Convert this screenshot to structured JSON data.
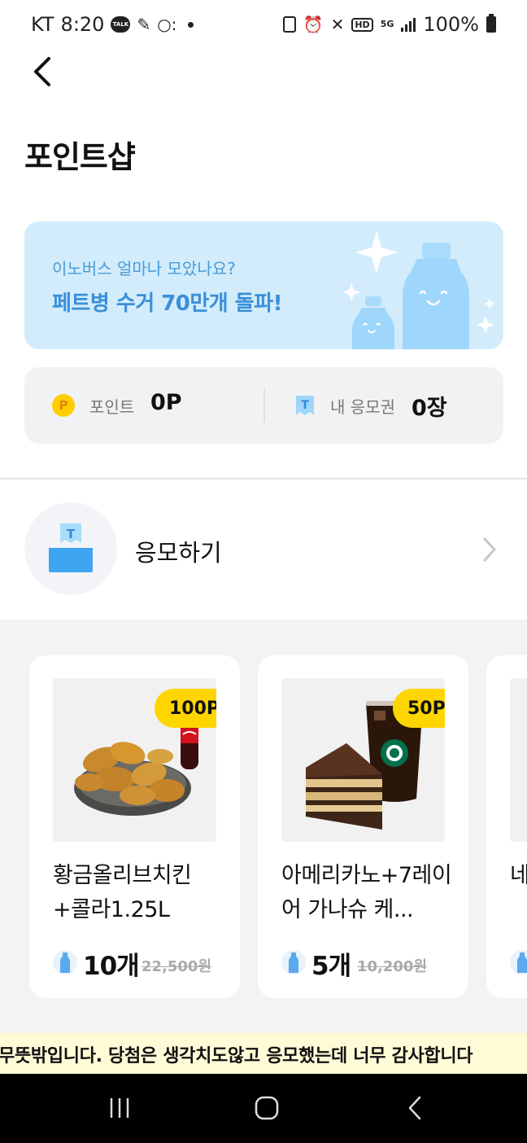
{
  "status_bar": {
    "carrier": "KT",
    "time": "8:20",
    "talk_badge": "TALK",
    "battery": "100%",
    "hd": "HD",
    "network": "5G"
  },
  "header": {
    "title": "포인트샵"
  },
  "banner": {
    "subtitle": "이노버스 얼마나 모았나요?",
    "title": "페트병 수거 70만개 돌파!"
  },
  "points": {
    "coin_letter": "P",
    "label": "포인트",
    "value": "0P",
    "ticket_letter": "T",
    "ticket_label": "내 응모권",
    "ticket_value": "0장"
  },
  "enter": {
    "icon_letter": "T",
    "label": "응모하기"
  },
  "products": [
    {
      "badge": "100P",
      "name": "황금올리브치킨+콜라1.25L",
      "count": "10개",
      "price": "22,500원"
    },
    {
      "badge": "50P",
      "name": "아메리카노+7레이어 가나슈 케...",
      "count": "5개",
      "price": "10,200원"
    },
    {
      "name": "네트"
    }
  ],
  "ticker": {
    "text": "무뜻밖입니다. 당첨은 생각치도않고 응모했는데 너무 감사합니다"
  },
  "colors": {
    "accent_yellow": "#ffd500",
    "banner_bg": "#d2ecfc",
    "banner_text": "#3a8fd9",
    "ticket_blue": "#4aa8f0"
  },
  "icons": {
    "back": "back-arrow-icon",
    "chevron": "chevron-right-icon",
    "bottle": "bottle-icon",
    "nav_recent": "recent-apps-icon",
    "nav_home": "home-icon",
    "nav_back": "nav-back-icon"
  }
}
